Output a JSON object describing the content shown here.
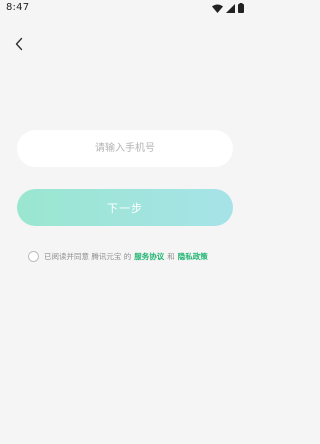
{
  "status_bar": {
    "time": "8:47",
    "icons": [
      "wifi-icon",
      "signal-icon",
      "battery-icon"
    ]
  },
  "nav": {
    "back_icon": "chevron-left-icon"
  },
  "login": {
    "phone_placeholder": "请输入手机号",
    "phone_value": "",
    "next_label": "下一步",
    "next_gradient": [
      "#9ae6d0",
      "#a6e3e8"
    ]
  },
  "agreement": {
    "checked": false,
    "prefix": "已阅读并同意 腾讯元宝 的",
    "service_link": "服务协议",
    "conjunction": "和",
    "privacy_link": "隐私政策",
    "link_color": "#22b573"
  }
}
